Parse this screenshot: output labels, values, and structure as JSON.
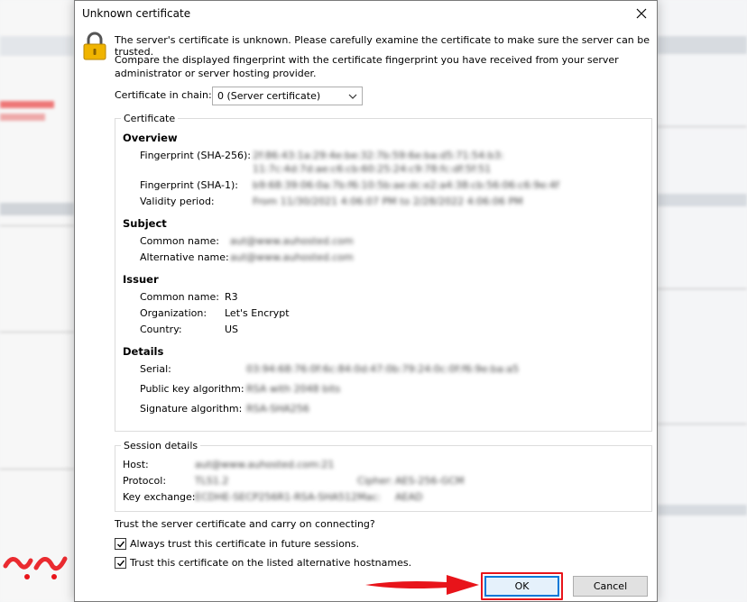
{
  "dialog": {
    "title": "Unknown certificate",
    "message": "The server's certificate is unknown. Please carefully examine the certificate to make sure the server can be trusted.",
    "compare_text": "Compare the displayed fingerprint with the certificate fingerprint you have received from your server administrator or server hosting provider.",
    "chain_label": "Certificate in chain:",
    "chain_selected": "0 (Server certificate)"
  },
  "certificate": {
    "group_title": "Certificate",
    "overview": {
      "heading": "Overview",
      "fp256_label": "Fingerprint (SHA-256):",
      "fp256_value_1": "2f:86:43:1a:29:4e:be:32:7b:59:6e:ba:d5:71:54:b3:",
      "fp256_value_2": "11:7c:4d:7d:ae:c6:cb:60:25:24:c9:78:fc:df:5f:51",
      "fp1_label": "Fingerprint (SHA-1):",
      "fp1_value": "b9:68:39:06:0a:7b:f6:10:5b:ae:dc:e2:a4:38:cb:56:06:c6:9e:4f",
      "validity_label": "Validity period:",
      "validity_value": "From 11/30/2021 4:06:07 PM to 2/28/2022 4:06:06 PM"
    },
    "subject": {
      "heading": "Subject",
      "common_label": "Common name:",
      "common_value": "aut@www.auhosted.com",
      "alt_label": "Alternative name:",
      "alt_value": "aut@www.auhosted.com"
    },
    "issuer": {
      "heading": "Issuer",
      "common_label": "Common name:",
      "common_value": "R3",
      "org_label": "Organization:",
      "org_value": "Let's Encrypt",
      "country_label": "Country:",
      "country_value": "US"
    },
    "details": {
      "heading": "Details",
      "serial_label": "Serial:",
      "serial_value": "03:94:68:76:0f:6c:84:0d:47:0b:79:24:0c:0f:f6:9e:ba:a5",
      "pubkey_label": "Public key algorithm:",
      "pubkey_value": "RSA with 2048 bits",
      "sig_label": "Signature algorithm:",
      "sig_value": "RSA-SHA256"
    }
  },
  "session": {
    "group_title": "Session details",
    "host_label": "Host:",
    "host_value": "aut@www.auhosted.com:21",
    "protocol_label": "Protocol:",
    "protocol_value": "TLS1.2",
    "cipher_label": "Cipher:",
    "cipher_value": "AES-256-GCM",
    "kex_label": "Key exchange:",
    "kex_value": "ECDHE-SECP256R1-RSA-SHA512",
    "mac_label": "Mac:",
    "mac_value": "AEAD"
  },
  "trust": {
    "question": "Trust the server certificate and carry on connecting?",
    "always_label": "Always trust this certificate in future sessions.",
    "always_checked": true,
    "alt_label": "Trust this certificate on the listed alternative hostnames.",
    "alt_checked": true
  },
  "buttons": {
    "ok": "OK",
    "cancel": "Cancel"
  },
  "colors": {
    "highlight": "#e8141a",
    "focus_border": "#0078d7",
    "lock_body": "#f0b400"
  },
  "icons": [
    "lock-icon",
    "close-icon",
    "chevron-down-icon",
    "checkmark-icon",
    "arrow-icon"
  ]
}
